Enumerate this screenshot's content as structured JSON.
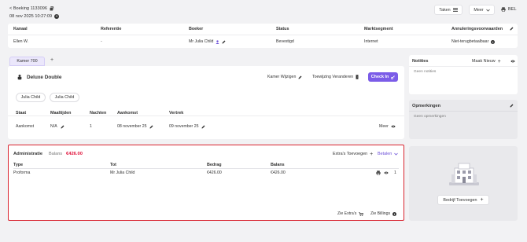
{
  "top": {
    "back_label": "< Boeking 1133096",
    "datetime": "08 nov 2025 10:27:09",
    "tasks_label": "Taken",
    "more_label": "Meer",
    "lang_label": "BEL"
  },
  "booking": {
    "headers": [
      "Kanaal",
      "Referentie",
      "Boeker",
      "Status",
      "Marktsegment",
      "Annuleringsvoorwaarden"
    ],
    "values": [
      "Ellen W.",
      "-",
      "Mr Julia Child",
      "Bevestigd",
      "Internet",
      "Niet-terugbetaalbaar"
    ]
  },
  "room": {
    "tab_label": "Kamer 700",
    "add_tab": "+",
    "room_name": "Deluxe Double",
    "change_room": "Kamer Wijzigen",
    "change_assign": "Toewijzing Veranderen",
    "checkin_label": "Check In",
    "guests": [
      "Julia Child",
      "Julia Child"
    ],
    "headers": [
      "Staat",
      "Maaltijden",
      "Nachten",
      "Aankomst",
      "Vertrek"
    ],
    "values": [
      "Aankomst",
      "N/A",
      "1",
      "08 november 25",
      "09 november 25"
    ],
    "more_label": "Meer"
  },
  "notes": {
    "title": "Notities",
    "new_label": "Maak Nieuw",
    "empty": "Geen notities"
  },
  "remarks": {
    "title": "Opmerkingen",
    "empty": "Geen opmerkingen"
  },
  "admin": {
    "title": "Administratie",
    "balance_label": "Balans",
    "balance_value": "€426.00",
    "extras_add": "Extra's Toevoegen",
    "pay_label": "Betalen",
    "headers": [
      "Type",
      "Tot",
      "Bedrag",
      "Balans"
    ],
    "row": [
      "Proforma",
      "Mr Julia Child",
      "€426.00",
      "€426.00"
    ],
    "row_count": "1",
    "see_extras": "Zie Extra's",
    "see_billings": "Zie Billings"
  },
  "company": {
    "add_label": "Bedrijf Toevoegen"
  },
  "colors": {
    "accent": "#7b5ce8",
    "highlight": "#e0123a",
    "red_border": "#d9232e"
  }
}
